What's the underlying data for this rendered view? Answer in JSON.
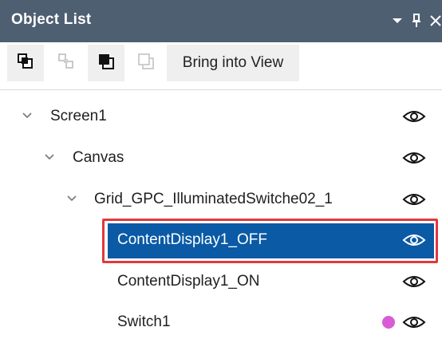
{
  "panel": {
    "title": "Object List",
    "title_icons": [
      "dropdown-arrow-icon",
      "pin-icon",
      "close-icon"
    ]
  },
  "toolbar": {
    "buttons": [
      {
        "name": "bring-to-front-icon",
        "enabled": true
      },
      {
        "name": "bring-forward-icon",
        "enabled": false
      },
      {
        "name": "send-to-back-icon",
        "enabled": true
      },
      {
        "name": "send-backward-icon",
        "enabled": false
      }
    ],
    "bring_into_view_label": "Bring into View"
  },
  "tree": {
    "items": [
      {
        "label": "Screen1",
        "expanded": true,
        "depth": 0,
        "visible": true
      },
      {
        "label": "Canvas",
        "expanded": true,
        "depth": 1,
        "visible": true
      },
      {
        "label": "Grid_GPC_IlluminatedSwitche02_1",
        "expanded": true,
        "depth": 2,
        "visible": true
      },
      {
        "label": "ContentDisplay1_OFF",
        "depth": 3,
        "selected": true,
        "visible": true
      },
      {
        "label": "ContentDisplay1_ON",
        "depth": 3,
        "visible": true
      },
      {
        "label": "Switch1",
        "depth": 3,
        "visible": true,
        "indicator_color": "#d95cd6"
      }
    ]
  },
  "colors": {
    "titlebar": "#4f5f72",
    "selection": "#0a5aa6",
    "highlight_border": "#e0393e"
  }
}
